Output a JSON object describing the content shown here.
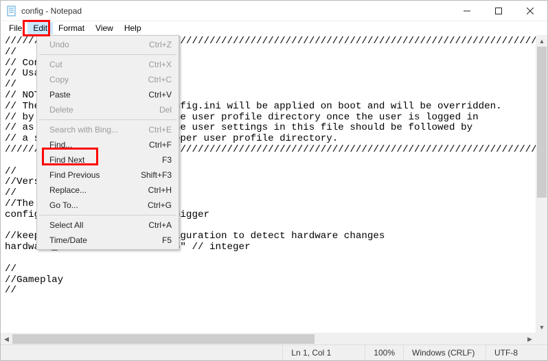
{
  "window": {
    "title": "config - Notepad"
  },
  "menubar": {
    "file": "File",
    "edit": "Edit",
    "format": "Format",
    "view": "View",
    "help": "Help"
  },
  "edit_menu": {
    "undo": {
      "label": "Undo",
      "accel": "Ctrl+Z",
      "enabled": false
    },
    "cut": {
      "label": "Cut",
      "accel": "Ctrl+X",
      "enabled": false
    },
    "copy": {
      "label": "Copy",
      "accel": "Ctrl+C",
      "enabled": false
    },
    "paste": {
      "label": "Paste",
      "accel": "Ctrl+V",
      "enabled": true
    },
    "delete": {
      "label": "Delete",
      "accel": "Del",
      "enabled": false
    },
    "search_bing": {
      "label": "Search with Bing...",
      "accel": "Ctrl+E",
      "enabled": false
    },
    "find": {
      "label": "Find...",
      "accel": "Ctrl+F",
      "enabled": true
    },
    "find_next": {
      "label": "Find Next",
      "accel": "F3",
      "enabled": true
    },
    "find_previous": {
      "label": "Find Previous",
      "accel": "Shift+F3",
      "enabled": true
    },
    "replace": {
      "label": "Replace...",
      "accel": "Ctrl+H",
      "enabled": true
    },
    "goto": {
      "label": "Go To...",
      "accel": "Ctrl+G",
      "enabled": true
    },
    "select_all": {
      "label": "Select All",
      "accel": "Ctrl+A",
      "enabled": true
    },
    "time_date": {
      "label": "Time/Date",
      "accel": "F5",
      "enabled": true
    }
  },
  "document": {
    "lines": [
      "//////////////////////////////////////////////////////////////////////////////////////////////////",
      "//",
      "// Configuration file",
      "// Usage: config.ini",
      "//",
      "// NOTE:",
      "// The settings in players/config.ini will be applied on boot and will be overridden.",
      "// by the settings found in the user profile directory once the user is logged in",
      "// as such, modification of the user settings in this file should be followed by",
      "// a similar change in the proper user profile directory.",
      "//////////////////////////////////////////////////////////////////////////////////////////////////",
      "",
      "//",
      "//Version",
      "//",
      "//The config version",
      "config_version = \"7\" // 0 or bigger",
      "",
      "//keep track of hardware configuration to detect hardware changes",
      "hardware_checksum = \"464945276\" // integer",
      "",
      "//",
      "//Gameplay",
      "//"
    ]
  },
  "status": {
    "position": "Ln 1, Col 1",
    "zoom": "100%",
    "line_ending": "Windows (CRLF)",
    "encoding": "UTF-8"
  }
}
